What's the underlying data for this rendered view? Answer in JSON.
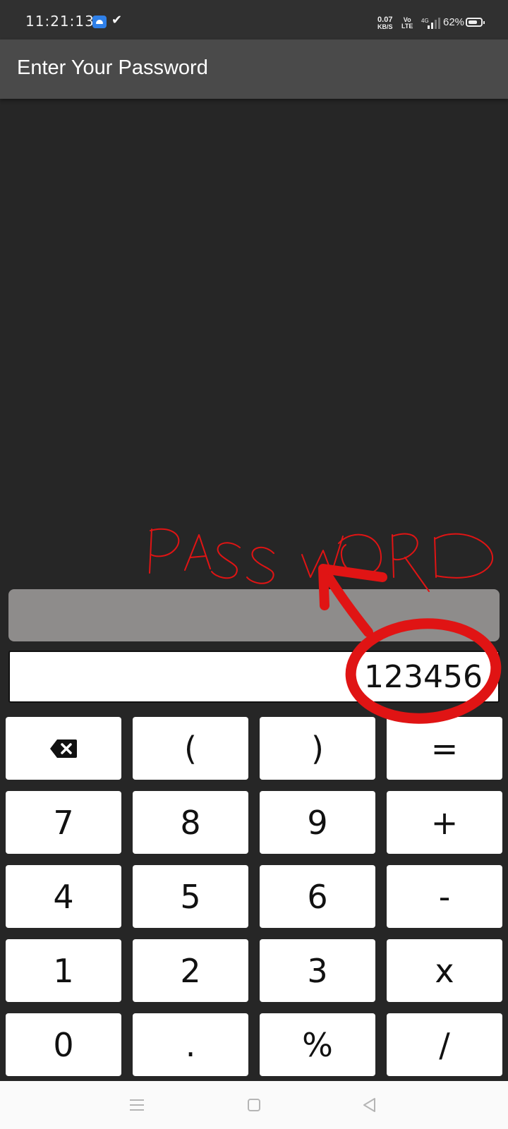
{
  "status_bar": {
    "time": "11:21:13",
    "net_speed_value": "0.07",
    "net_speed_unit": "KB/S",
    "volte_top": "Vo",
    "volte_bottom": "LTE",
    "battery_percent": "62%",
    "network_type": "4G"
  },
  "app_bar": {
    "title": "Enter Your Password"
  },
  "annotation": {
    "handwritten_text": "PASSWORD",
    "stroke_color": "#e01414"
  },
  "display": {
    "result": "",
    "input_value": "123456"
  },
  "keypad": {
    "rows": [
      [
        {
          "label": "",
          "name": "backspace-key",
          "icon": "backspace-icon"
        },
        {
          "label": "(",
          "name": "open-paren-key"
        },
        {
          "label": ")",
          "name": "close-paren-key"
        },
        {
          "label": "=",
          "name": "equals-key"
        }
      ],
      [
        {
          "label": "7",
          "name": "digit-7-key"
        },
        {
          "label": "8",
          "name": "digit-8-key"
        },
        {
          "label": "9",
          "name": "digit-9-key"
        },
        {
          "label": "+",
          "name": "plus-key"
        }
      ],
      [
        {
          "label": "4",
          "name": "digit-4-key"
        },
        {
          "label": "5",
          "name": "digit-5-key"
        },
        {
          "label": "6",
          "name": "digit-6-key"
        },
        {
          "label": "-",
          "name": "minus-key"
        }
      ],
      [
        {
          "label": "1",
          "name": "digit-1-key"
        },
        {
          "label": "2",
          "name": "digit-2-key"
        },
        {
          "label": "3",
          "name": "digit-3-key"
        },
        {
          "label": "x",
          "name": "multiply-key"
        }
      ],
      [
        {
          "label": "0",
          "name": "digit-0-key"
        },
        {
          "label": ".",
          "name": "decimal-key"
        },
        {
          "label": "%",
          "name": "percent-key"
        },
        {
          "label": "/",
          "name": "divide-key"
        }
      ]
    ]
  },
  "nav_bar": {
    "icons": [
      "menu-icon",
      "home-icon",
      "back-icon"
    ]
  },
  "colors": {
    "background": "#262626",
    "app_bar": "#4a4a4a",
    "result_bar": "#8e8c8b",
    "key_background": "#ffffff",
    "annotation_red": "#e01414"
  }
}
